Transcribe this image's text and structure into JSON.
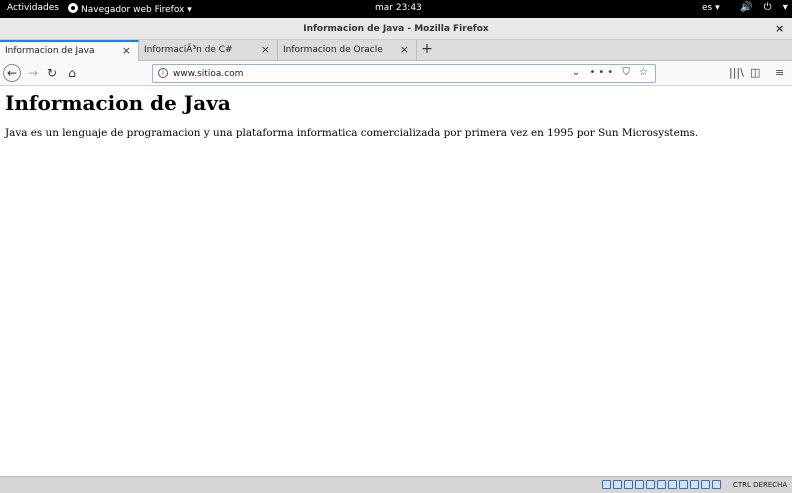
{
  "system_bar": {
    "activities": "Actividades",
    "app_menu": "Navegador web Firefox ▾",
    "clock": "mar 23:43",
    "language": "es ▾",
    "tray": "🔊 ⏻ ▾"
  },
  "window": {
    "title": "Informacion de Java - Mozilla Firefox",
    "close_glyph": "×"
  },
  "tabs": [
    {
      "label": "Informacion de Java",
      "active": true
    },
    {
      "label": "InformaciÃ³n de C#",
      "active": false
    },
    {
      "label": "Informacion de Oracle",
      "active": false
    }
  ],
  "tab_close_glyph": "×",
  "new_tab_glyph": "+",
  "navbar": {
    "back_glyph": "←",
    "forward_glyph": "→",
    "reload_glyph": "↻",
    "home_glyph": "⌂",
    "info_glyph": "i",
    "url": "www.sitioa.com",
    "url_icons": "⌄ ••• ⛉ ☆",
    "library_glyph": "|||\\",
    "sidebar_glyph": "◫",
    "menu_glyph": "≡"
  },
  "page": {
    "heading": "Informacion de Java",
    "paragraph": "Java es un lenguaje de programacion y una plataforma informatica comercializada por primera vez en 1995 por Sun Microsystems."
  },
  "vbox_status": {
    "host_key": "CTRL DERECHA"
  }
}
